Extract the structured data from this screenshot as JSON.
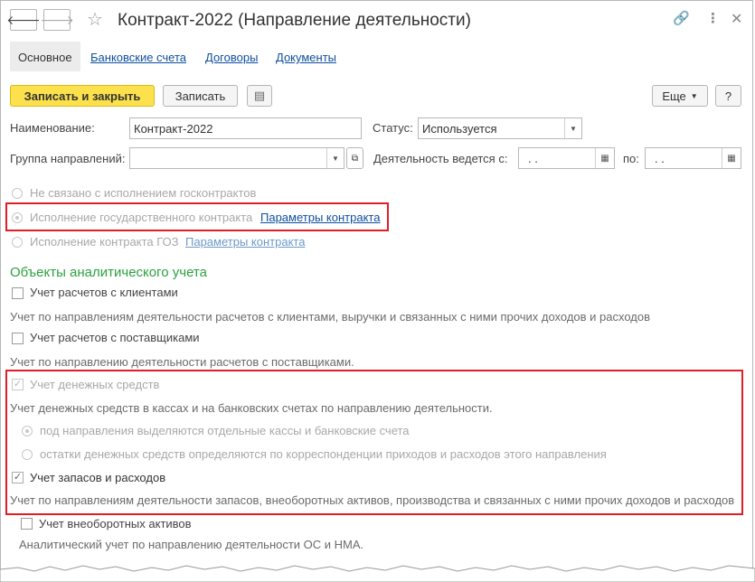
{
  "window": {
    "title": "Контракт-2022 (Направление деятельности)",
    "icons": [
      "back-arrow-icon",
      "forward-arrow-icon",
      "star-icon",
      "link-icon",
      "more-vertical-icon",
      "close-icon"
    ]
  },
  "tabs": {
    "active": "Основное",
    "links": [
      "Банковские счета",
      "Договоры",
      "Документы"
    ]
  },
  "toolbar": {
    "save_close": "Записать и закрыть",
    "save": "Записать",
    "more": "Еще",
    "help": "?"
  },
  "form": {
    "name_label": "Наименование:",
    "name_value": "Контракт-2022",
    "status_label": "Статус:",
    "status_value": "Используется",
    "group_label": "Группа направлений:",
    "group_value": "",
    "activity_label": "Деятельность ведется с:",
    "date_from": " .  . ",
    "to_label": "по:",
    "date_to": " .  . "
  },
  "contract_type": {
    "opt1": "Не связано с исполнением госконтрактов",
    "opt2": "Исполнение государственного контракта",
    "opt2_link": "Параметры контракта",
    "opt3": "Исполнение контракта ГОЗ",
    "opt3_link": "Параметры контракта"
  },
  "analytics": {
    "section_title": "Объекты аналитического учета",
    "clients_label": "Учет расчетов с клиентами",
    "clients_note": "Учет по направлениям деятельности расчетов с клиентами, выручки и связанных с ними прочих доходов и расходов",
    "suppliers_label": "Учет расчетов с поставщиками",
    "suppliers_note": "Учет по направлению деятельности расчетов с поставщиками.",
    "cash_label": "Учет денежных средств",
    "cash_note": "Учет денежных средств в кассах и на банковских счетах по направлению деятельности.",
    "cash_opt1": "под направления выделяются отдельные кассы и банковские счета",
    "cash_opt2": "остатки денежных средств определяются по корреспонденции приходов и расходов этого направления",
    "stock_label": "Учет запасов и расходов",
    "stock_note": "Учет по направлениям деятельности запасов, внеоборотных активов, производства и связанных с ними прочих доходов и расходов",
    "assets_label": "Учет внеоборотных активов",
    "assets_note": "Аналитический учет по направлению деятельности ОС и НМА."
  },
  "colors": {
    "primary_button": "#fce14c",
    "section_title": "#2aa140",
    "highlight_box": "#e01e26",
    "link": "#0f4f9e"
  }
}
